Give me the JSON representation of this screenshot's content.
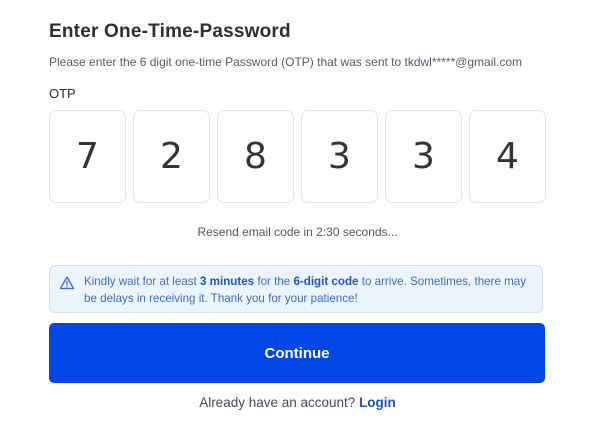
{
  "title": "Enter One-Time-Password",
  "subtitle": "Please enter the 6 digit one-time Password (OTP) that was sent to tkdwl*****@gmail.com",
  "otp": {
    "label": "OTP",
    "digits": [
      "7",
      "2",
      "8",
      "3",
      "3",
      "4"
    ]
  },
  "resend_text": "Resend email code in 2:30 seconds...",
  "notice": {
    "icon": "warning-triangle-icon",
    "part1": "Kindly wait for at least ",
    "bold1": "3 minutes",
    "part2": " for the ",
    "bold2": "6-digit code",
    "part3": " to arrive. Sometimes, there may be delays in receiving it. Thank you for your patience!",
    "bg_color": "#ecf4fd",
    "text_color": "#3d6ec4"
  },
  "continue_button": {
    "label": "Continue",
    "color": "#0047e6"
  },
  "login_prompt": {
    "text": "Already have an account?",
    "link": "Login"
  }
}
